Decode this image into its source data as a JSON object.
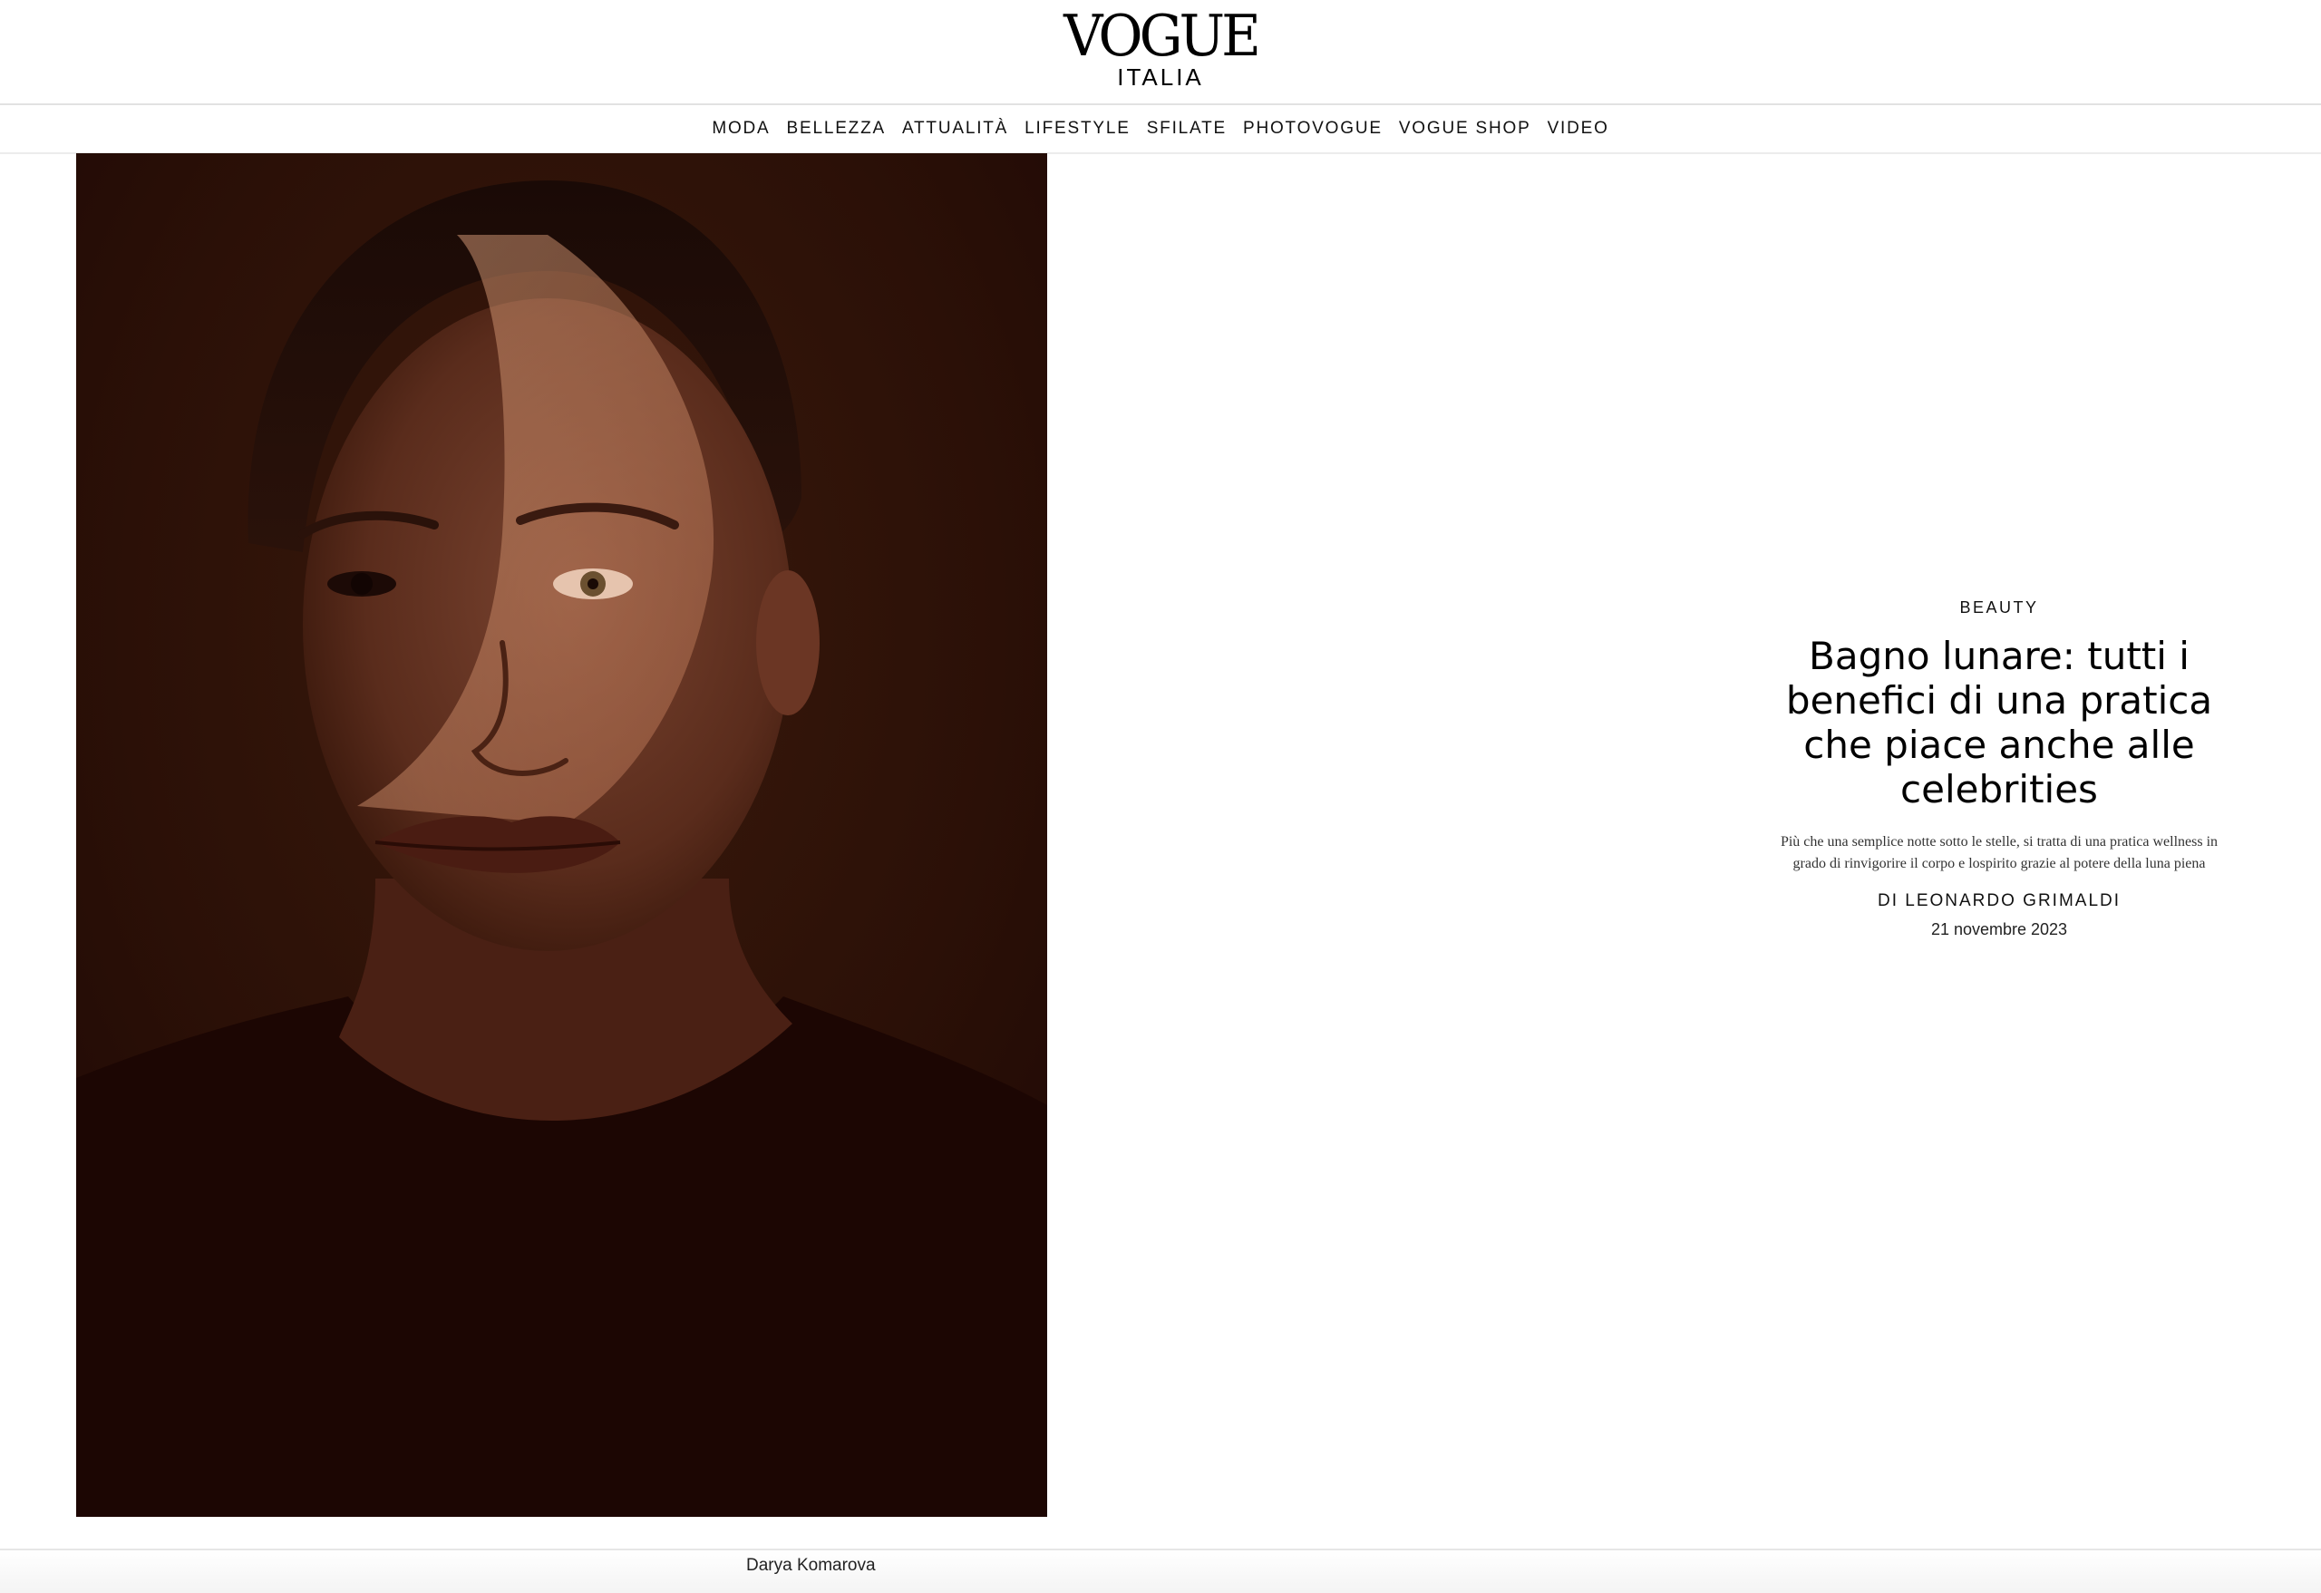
{
  "header": {
    "logo_main": "VOGUE",
    "logo_sub": "ITALIA"
  },
  "nav": {
    "items": [
      {
        "label": "MODA"
      },
      {
        "label": "BELLEZZA"
      },
      {
        "label": "ATTUALITÀ"
      },
      {
        "label": "LIFESTYLE"
      },
      {
        "label": "SFILATE"
      },
      {
        "label": "PHOTOVOGUE"
      },
      {
        "label": "VOGUE SHOP"
      },
      {
        "label": "VIDEO"
      }
    ]
  },
  "article": {
    "kicker": "BEAUTY",
    "headline": "Bagno lunare: tutti i benefici di una pratica che piace anche alle celebrities",
    "dek": "Più che una semplice notte sotto le stelle, si tratta di una pratica wellness in grado di rinvigorire il corpo e lospirito grazie al potere della luna piena",
    "byline_prefix": "DI",
    "author": "LEONARDO GRIMALDI",
    "date": "21 novembre 2023"
  },
  "photo": {
    "credit": "Darya Komarova",
    "background_color": "#2a0d06",
    "highlight_color": "#c88a64"
  }
}
